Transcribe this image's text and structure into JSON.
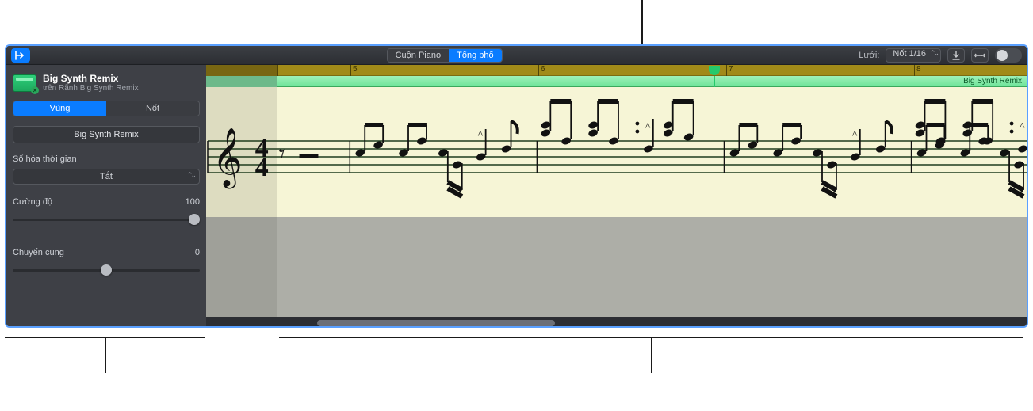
{
  "toolbar": {
    "view_tabs": {
      "piano_roll": "Cuộn Piano",
      "score": "Tổng phổ"
    },
    "grid_label": "Lưới:",
    "grid_value": "Nốt 1/16"
  },
  "inspector": {
    "region_title": "Big Synth Remix",
    "region_sub": "trên Rãnh Big Synth Remix",
    "tabs": {
      "region": "Vùng",
      "note": "Nốt"
    },
    "name_field": "Big Synth Remix",
    "quantize_label": "Số hóa thời gian",
    "quantize_value": "Tắt",
    "velocity_label": "Cường độ",
    "velocity_value": "100",
    "transpose_label": "Chuyển cung",
    "transpose_value": "0"
  },
  "score": {
    "ruler_numbers": [
      "5",
      "6",
      "7",
      "8"
    ],
    "region_name": "Big Synth Remix",
    "time_sig_top": "4",
    "time_sig_bottom": "4"
  }
}
